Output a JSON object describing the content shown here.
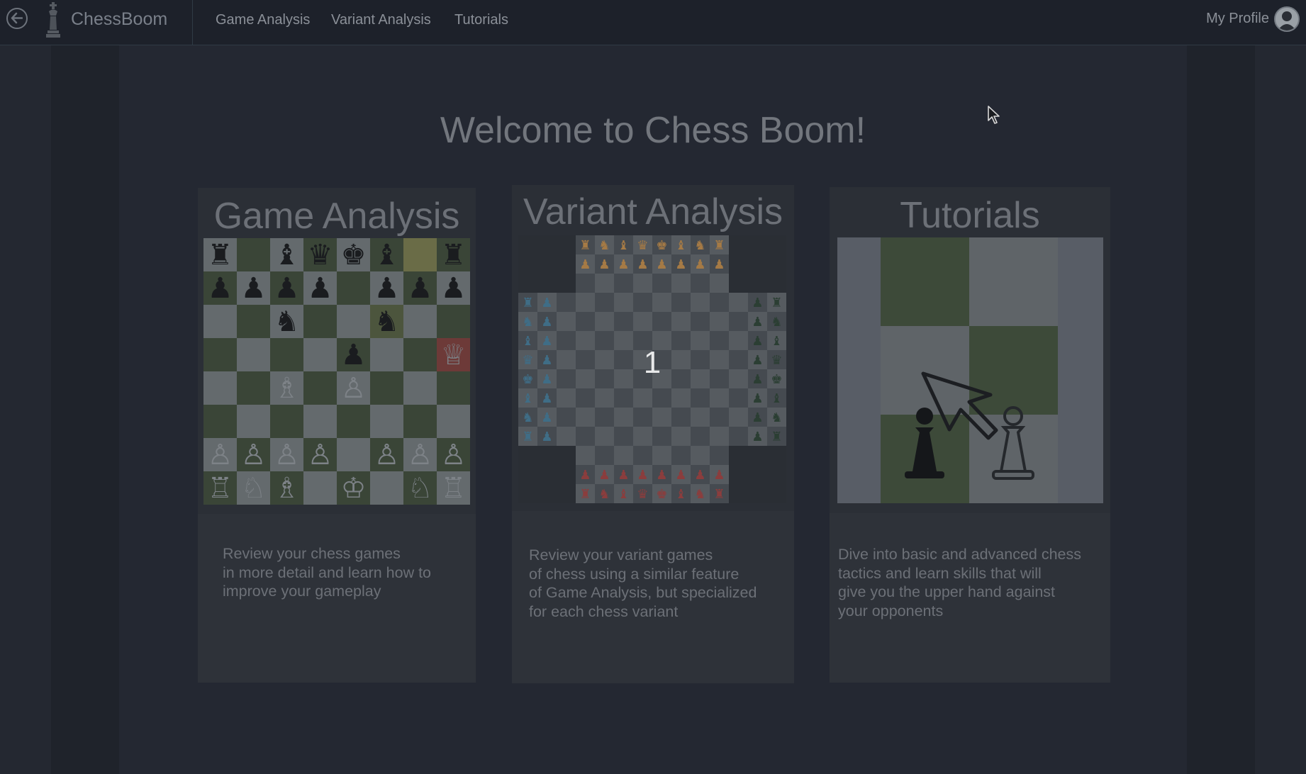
{
  "nav": {
    "brand": "ChessBoom",
    "links": [
      "Game Analysis",
      "Variant Analysis",
      "Tutorials"
    ],
    "profile": "My Profile"
  },
  "welcome": "Welcome to Chess Boom!",
  "cards": [
    {
      "title": "Game Analysis",
      "description": "Review your chess games\nin more detail and learn how to\nimprove your gameplay"
    },
    {
      "title": "Variant Analysis",
      "description": "Review your variant games\nof chess using a similar feature\nof Game Analysis, but specialized\nfor each chess variant",
      "countdown": "1"
    },
    {
      "title": "Tutorials",
      "description": "Dive into basic and advanced chess\ntactics and learn skills that will\ngive you the upper hand against\nyour opponents"
    }
  ],
  "colors": {
    "background": "#222630",
    "navbar": "#1d212a",
    "card": "#2e3239",
    "text_muted": "#6c7077",
    "board_dark": "#3a4537",
    "board_light": "#646a6d"
  },
  "icons": {
    "back": "arrow-left-circle-icon",
    "logo": "chess-king-icon",
    "avatar": "user-avatar-icon",
    "cursor": "mouse-pointer-icon"
  }
}
